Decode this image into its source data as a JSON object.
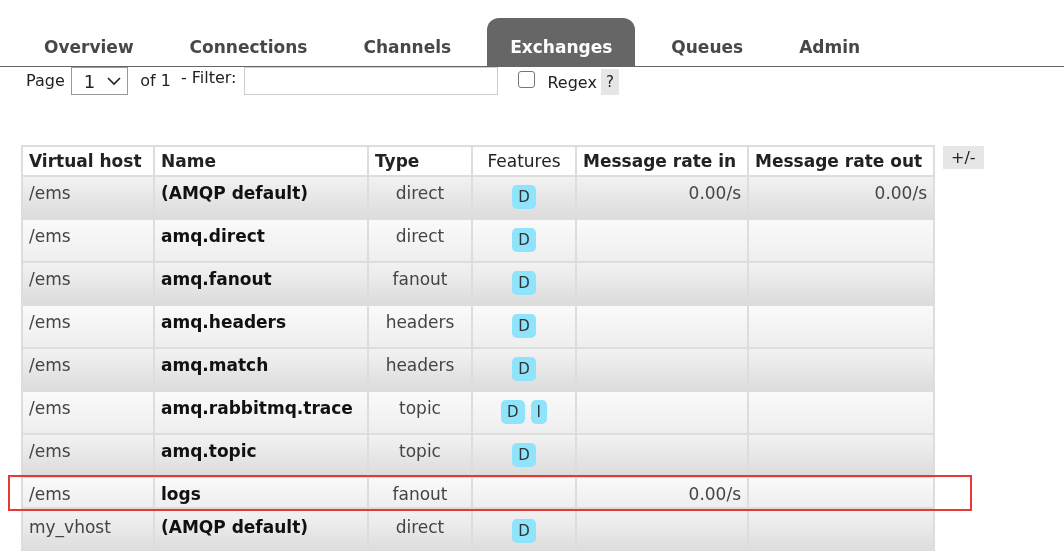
{
  "tabs": [
    {
      "label": "Overview",
      "selected": false
    },
    {
      "label": "Connections",
      "selected": false
    },
    {
      "label": "Channels",
      "selected": false
    },
    {
      "label": "Exchanges",
      "selected": true
    },
    {
      "label": "Queues",
      "selected": false
    },
    {
      "label": "Admin",
      "selected": false
    }
  ],
  "pager": {
    "page_label": "Page",
    "page": "1",
    "of_label": "of 1",
    "filter_label": "- Filter:",
    "regex_label": "Regex",
    "regex_checked": false,
    "help": "?"
  },
  "table": {
    "columns": [
      "Virtual host",
      "Name",
      "Type",
      "Features",
      "Message rate in",
      "Message rate out"
    ],
    "toggle": "+/-",
    "rows": [
      {
        "vhost": "/ems",
        "name": "(AMQP default)",
        "type": "direct",
        "features": [
          "D"
        ],
        "rate_in": "0.00/s",
        "rate_out": "0.00/s",
        "highlighted": false
      },
      {
        "vhost": "/ems",
        "name": "amq.direct",
        "type": "direct",
        "features": [
          "D"
        ],
        "highlighted": false
      },
      {
        "vhost": "/ems",
        "name": "amq.fanout",
        "type": "fanout",
        "features": [
          "D"
        ],
        "highlighted": false
      },
      {
        "vhost": "/ems",
        "name": "amq.headers",
        "type": "headers",
        "features": [
          "D"
        ],
        "highlighted": false
      },
      {
        "vhost": "/ems",
        "name": "amq.match",
        "type": "headers",
        "features": [
          "D"
        ],
        "highlighted": false
      },
      {
        "vhost": "/ems",
        "name": "amq.rabbitmq.trace",
        "type": "topic",
        "features": [
          "D",
          "I"
        ],
        "highlighted": false
      },
      {
        "vhost": "/ems",
        "name": "amq.topic",
        "type": "topic",
        "features": [
          "D"
        ],
        "highlighted": false
      },
      {
        "vhost": "/ems",
        "name": "logs",
        "type": "fanout",
        "features": [],
        "rate_in": "0.00/s",
        "highlighted": true
      },
      {
        "vhost": "my_vhost",
        "name": "(AMQP default)",
        "type": "direct",
        "features": [
          "D"
        ],
        "highlighted": false
      }
    ]
  }
}
